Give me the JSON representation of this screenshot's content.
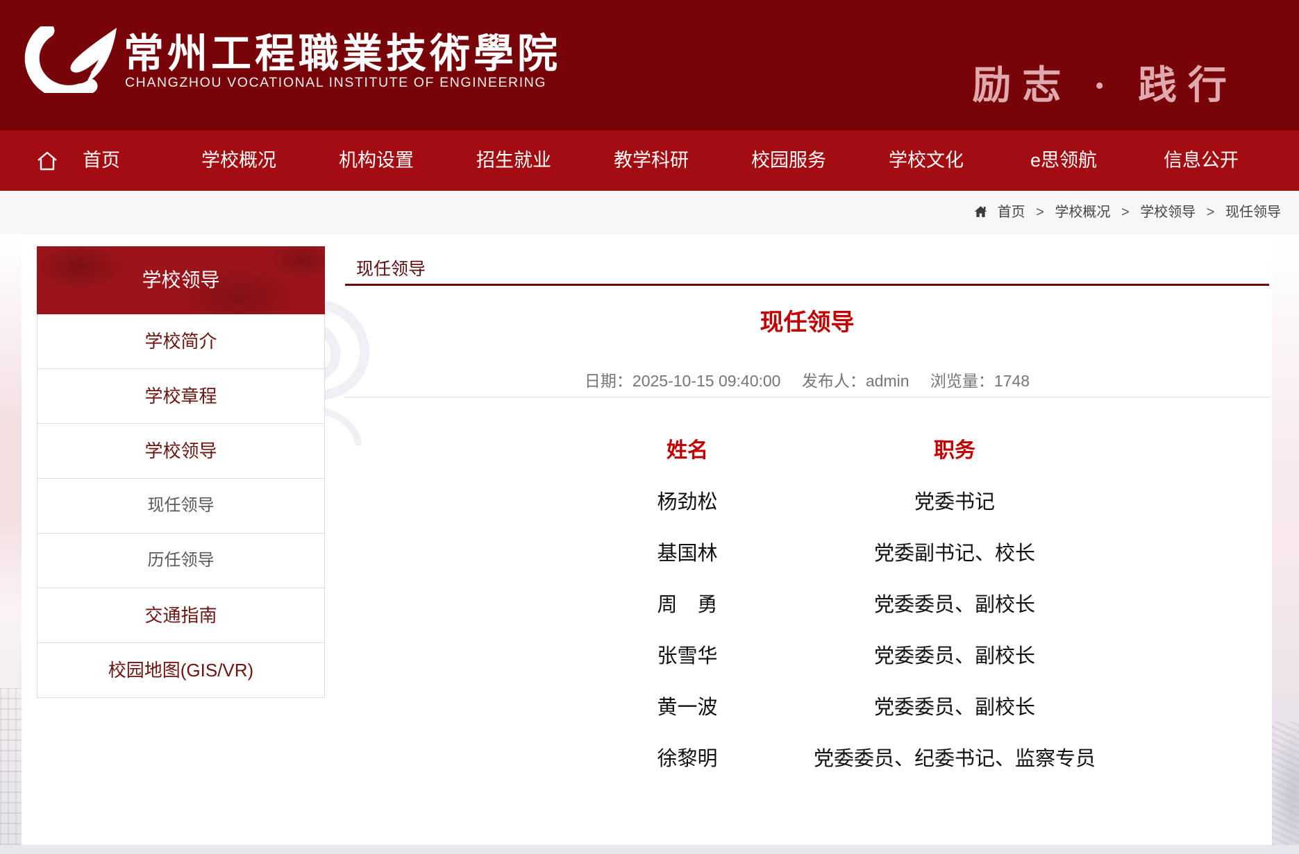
{
  "header": {
    "school_name_cn": "常州工程職業技術學院",
    "school_name_en": "CHANGZHOU VOCATIONAL INSTITUTE OF ENGINEERING",
    "slogan": "励志 · 践行"
  },
  "nav": {
    "items": [
      {
        "label": "首页"
      },
      {
        "label": "学校概况"
      },
      {
        "label": "机构设置"
      },
      {
        "label": "招生就业"
      },
      {
        "label": "教学科研"
      },
      {
        "label": "校园服务"
      },
      {
        "label": "学校文化"
      },
      {
        "label": "e思领航"
      },
      {
        "label": "信息公开"
      }
    ]
  },
  "breadcrumb": {
    "separator": ">",
    "items": [
      {
        "label": "首页"
      },
      {
        "label": "学校概况"
      },
      {
        "label": "学校领导"
      },
      {
        "label": "现任领导"
      }
    ]
  },
  "sidebar": {
    "title": "学校领导",
    "items": [
      {
        "label": "学校简介"
      },
      {
        "label": "学校章程"
      },
      {
        "label": "学校领导"
      },
      {
        "label": "现任领导"
      },
      {
        "label": "历任领导"
      },
      {
        "label": "交通指南"
      },
      {
        "label": "校园地图(GIS/VR)"
      }
    ]
  },
  "content": {
    "page_title": "现任领导",
    "article_title": "现任领导",
    "meta": {
      "date_label": "日期：",
      "date": "2025-10-15 09:40:00",
      "publisher_label": "发布人：",
      "publisher": "admin",
      "views_label": "浏览量：",
      "views": "1748"
    },
    "table": {
      "headers": [
        "姓名",
        "职务"
      ],
      "rows": [
        {
          "name": "杨劲松",
          "title": "党委书记"
        },
        {
          "name": "基国林",
          "title": "党委副书记、校长"
        },
        {
          "name": "周　勇",
          "title": "党委委员、副校长"
        },
        {
          "name": "张雪华",
          "title": "党委委员、副校长"
        },
        {
          "name": "黄一波",
          "title": "党委委员、副校长"
        },
        {
          "name": "徐黎明",
          "title": "党委委员、纪委书记、监察专员"
        }
      ]
    }
  },
  "colors": {
    "header_bg": "#770409",
    "nav_bg": "#a30c11",
    "sidebar_header_bg": "#9a141a",
    "accent_red": "#c00000",
    "dark_red_text": "#6a1510",
    "slogan_pink": "#dfa9ad"
  }
}
